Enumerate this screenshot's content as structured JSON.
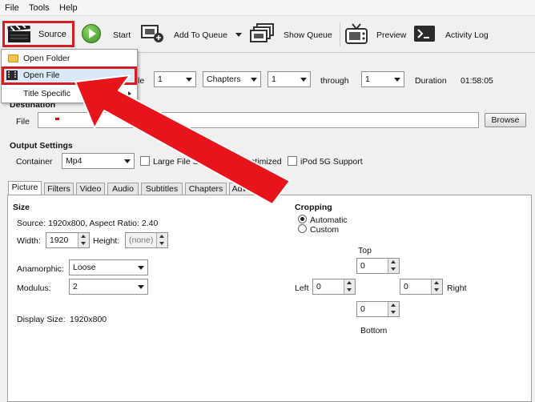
{
  "menubar": {
    "file": "File",
    "tools": "Tools",
    "help": "Help"
  },
  "toolbar": {
    "source": "Source",
    "start": "Start",
    "add_to_queue": "Add To Queue",
    "show_queue": "Show Queue",
    "preview": "Preview",
    "activity_log": "Activity Log"
  },
  "source_menu": {
    "open_folder": "Open Folder",
    "open_file": "Open File",
    "title_specific": "Title Specific"
  },
  "source_row": {
    "partial_label": "le",
    "angle_value": "1",
    "range_type": "Chapters",
    "range_start": "1",
    "through_label": "through",
    "range_end": "1",
    "duration_label": "Duration",
    "duration_value": "01:58:05"
  },
  "destination": {
    "section_label": "Destination",
    "file_label": "File",
    "file_value": "",
    "browse": "Browse"
  },
  "output": {
    "section_label": "Output Settings",
    "container_label": "Container",
    "container_value": "Mp4",
    "large_file_size": "Large File Size",
    "web_optimized": "Web Optimized",
    "ipod_5g": "iPod 5G Support"
  },
  "tabs": [
    "Picture",
    "Filters",
    "Video",
    "Audio",
    "Subtitles",
    "Chapters",
    "Advanced"
  ],
  "picture": {
    "size_label": "Size",
    "source_info": "Source:  1920x800, Aspect Ratio: 2.40",
    "width_label": "Width:",
    "width_value": "1920",
    "height_label": "Height:",
    "height_value": "(none)",
    "anamorphic_label": "Anamorphic:",
    "anamorphic_value": "Loose",
    "modulus_label": "Modulus:",
    "modulus_value": "2",
    "display_size_label": "Display Size:",
    "display_size_value": "1920x800"
  },
  "cropping": {
    "label": "Cropping",
    "automatic": "Automatic",
    "custom": "Custom",
    "selected": "Automatic",
    "top_label": "Top",
    "top": "0",
    "left_label": "Left",
    "left": "0",
    "right_label": "Right",
    "right": "0",
    "bottom_label": "Bottom",
    "bottom": "0"
  },
  "colors": {
    "highlight": "#d21f26",
    "arrow": "#e8141b",
    "menu_hover": "#dbe8f6"
  }
}
